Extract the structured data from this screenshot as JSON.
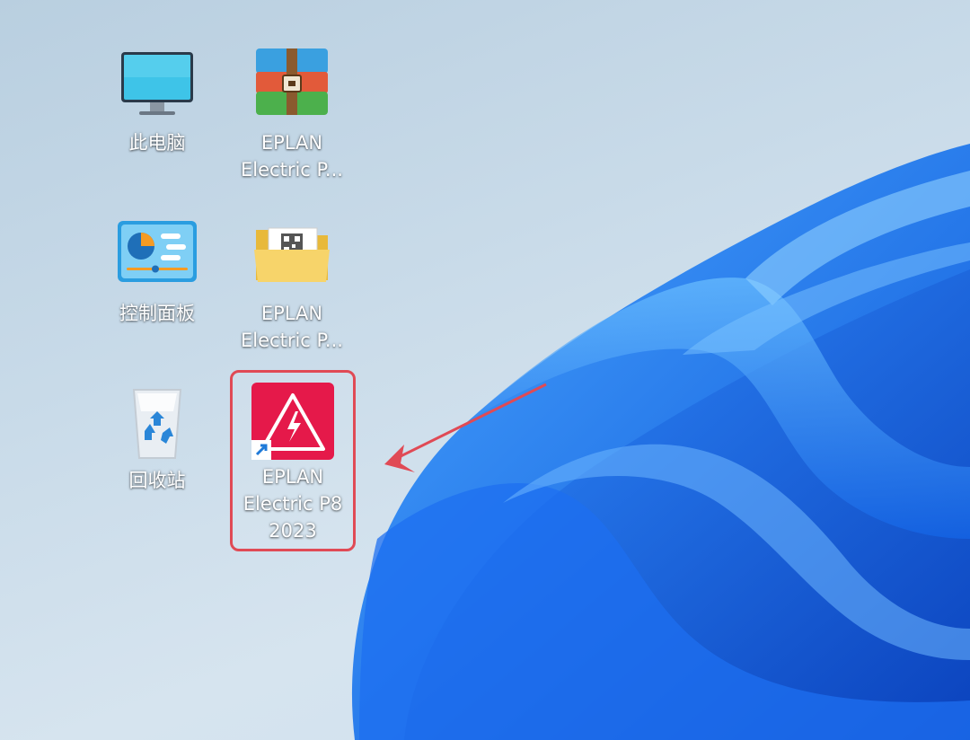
{
  "desktop": {
    "icons": [
      {
        "label": "此电脑",
        "icon": "monitor-icon"
      },
      {
        "label": "EPLAN\nElectric P...",
        "icon": "winrar-archive-icon"
      },
      {
        "label": "控制面板",
        "icon": "control-panel-icon"
      },
      {
        "label": "EPLAN\nElectric P...",
        "icon": "folder-icon"
      },
      {
        "label": "回收站",
        "icon": "recycle-bin-icon"
      },
      {
        "label": "EPLAN\nElectric P8\n2023",
        "icon": "eplan-shortcut-icon"
      }
    ]
  },
  "colors": {
    "highlight": "#e04a55",
    "eplan_red": "#e5194a",
    "wallpaper_blue": "#1a73e8"
  }
}
